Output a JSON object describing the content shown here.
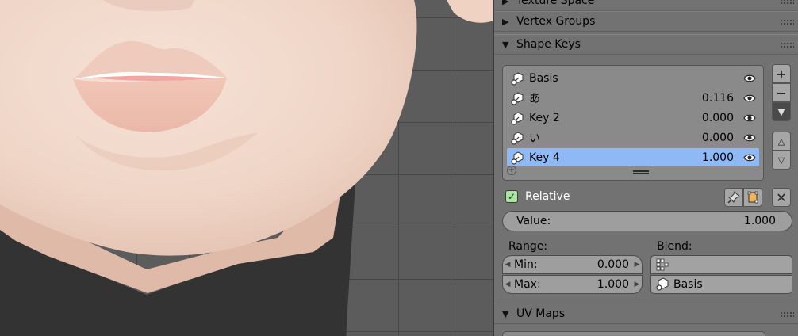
{
  "panels": {
    "texture_space": "Texture Space",
    "vertex_groups": "Vertex Groups",
    "shape_keys": "Shape Keys",
    "uv_maps": "UV Maps"
  },
  "shape_keys": [
    {
      "name": "Basis",
      "value": "",
      "selected": false
    },
    {
      "name": "あ",
      "value": "0.116",
      "selected": false
    },
    {
      "name": "Key 2",
      "value": "0.000",
      "selected": false
    },
    {
      "name": "い",
      "value": "0.000",
      "selected": false
    },
    {
      "name": "Key 4",
      "value": "1.000",
      "selected": true
    }
  ],
  "relative": {
    "label": "Relative",
    "checked": true
  },
  "value_field": {
    "label": "Value:",
    "value": "1.000"
  },
  "range": {
    "label": "Range:",
    "min_label": "Min:",
    "min_value": "0.000",
    "max_label": "Max:",
    "max_value": "1.000"
  },
  "blend": {
    "label": "Blend:",
    "vertex_group": "",
    "relative_key": "Basis"
  },
  "icons": {
    "key": "shape-key-icon",
    "eye": "eye-icon",
    "add": "plus-icon",
    "remove": "minus-icon",
    "specials": "chevron-down-icon",
    "move_up": "triangle-up-icon",
    "move_down": "triangle-down-icon",
    "pin": "pin-icon",
    "edit_mode": "edit-mode-icon",
    "clear": "close-icon"
  },
  "colors": {
    "panel_bg": "#727272",
    "selected_row": "#8fb9f5",
    "checkbox": "#a9e3a1",
    "skin": "#f0d6c8",
    "shirt": "#333333"
  }
}
